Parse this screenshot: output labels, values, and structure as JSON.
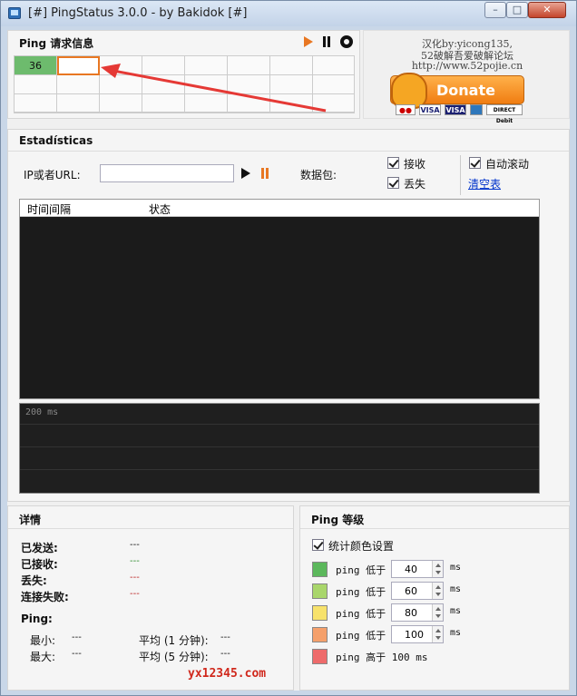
{
  "window": {
    "title": "[#] PingStatus 3.0.0 - by Bakidok [#]",
    "minimize": "–",
    "maximize": "□",
    "close": "✕"
  },
  "ping_info": {
    "title": "Ping 请求信息",
    "cells": [
      "36"
    ]
  },
  "credit": {
    "line1": "汉化by:yicong135,",
    "line2": "52破解吾爱破解论坛",
    "line3": "http://www.52pojie.cn"
  },
  "donate": {
    "label": "Donate",
    "cards": [
      "Maestro",
      "VISA",
      "VISA",
      "AMEX",
      "DIRECT Debit"
    ]
  },
  "stats": {
    "title": "Estadísticas",
    "ip_label": "IP或者URL:",
    "ip_value": "",
    "packets_label": "数据包:",
    "receive_label": "接收",
    "lost_label": "丢失",
    "autoscroll_label": "自动滚动",
    "clear_table": "清空表",
    "columns": [
      "时间间隔",
      "状态"
    ],
    "graph_label": "200 ms"
  },
  "details": {
    "title": "详情",
    "rows": [
      {
        "label": "已发送:",
        "value": "---"
      },
      {
        "label": "已接收:",
        "value": "---"
      },
      {
        "label": "丢失:",
        "value": "---"
      },
      {
        "label": "连接失败:",
        "value": "---"
      }
    ],
    "ping_title": "Ping:",
    "min_label": "最小:",
    "min_value": "---",
    "max_label": "最大:",
    "max_value": "---",
    "avg1_label": "平均 (1 分钟):",
    "avg1_value": "---",
    "avg5_label": "平均 (5 分钟):",
    "avg5_value": "---"
  },
  "levels": {
    "title": "Ping 等级",
    "color_setting": "统计颜色设置",
    "rows": [
      {
        "label": "ping 低于",
        "value": "40",
        "unit": "ms",
        "color": "#5cb85c"
      },
      {
        "label": "ping 低于",
        "value": "60",
        "unit": "ms",
        "color": "#a9d66b"
      },
      {
        "label": "ping 低于",
        "value": "80",
        "unit": "ms",
        "color": "#f7e26b"
      },
      {
        "label": "ping 低于",
        "value": "100",
        "unit": "ms",
        "color": "#f5a06b"
      }
    ],
    "last_label": "ping 高于 100 ms",
    "last_color": "#ee6b6b"
  },
  "watermark": "yx12345.com",
  "colors": {
    "accent": "#e87722",
    "green_cell": "#6dbb6d",
    "arrow": "#e53935"
  }
}
